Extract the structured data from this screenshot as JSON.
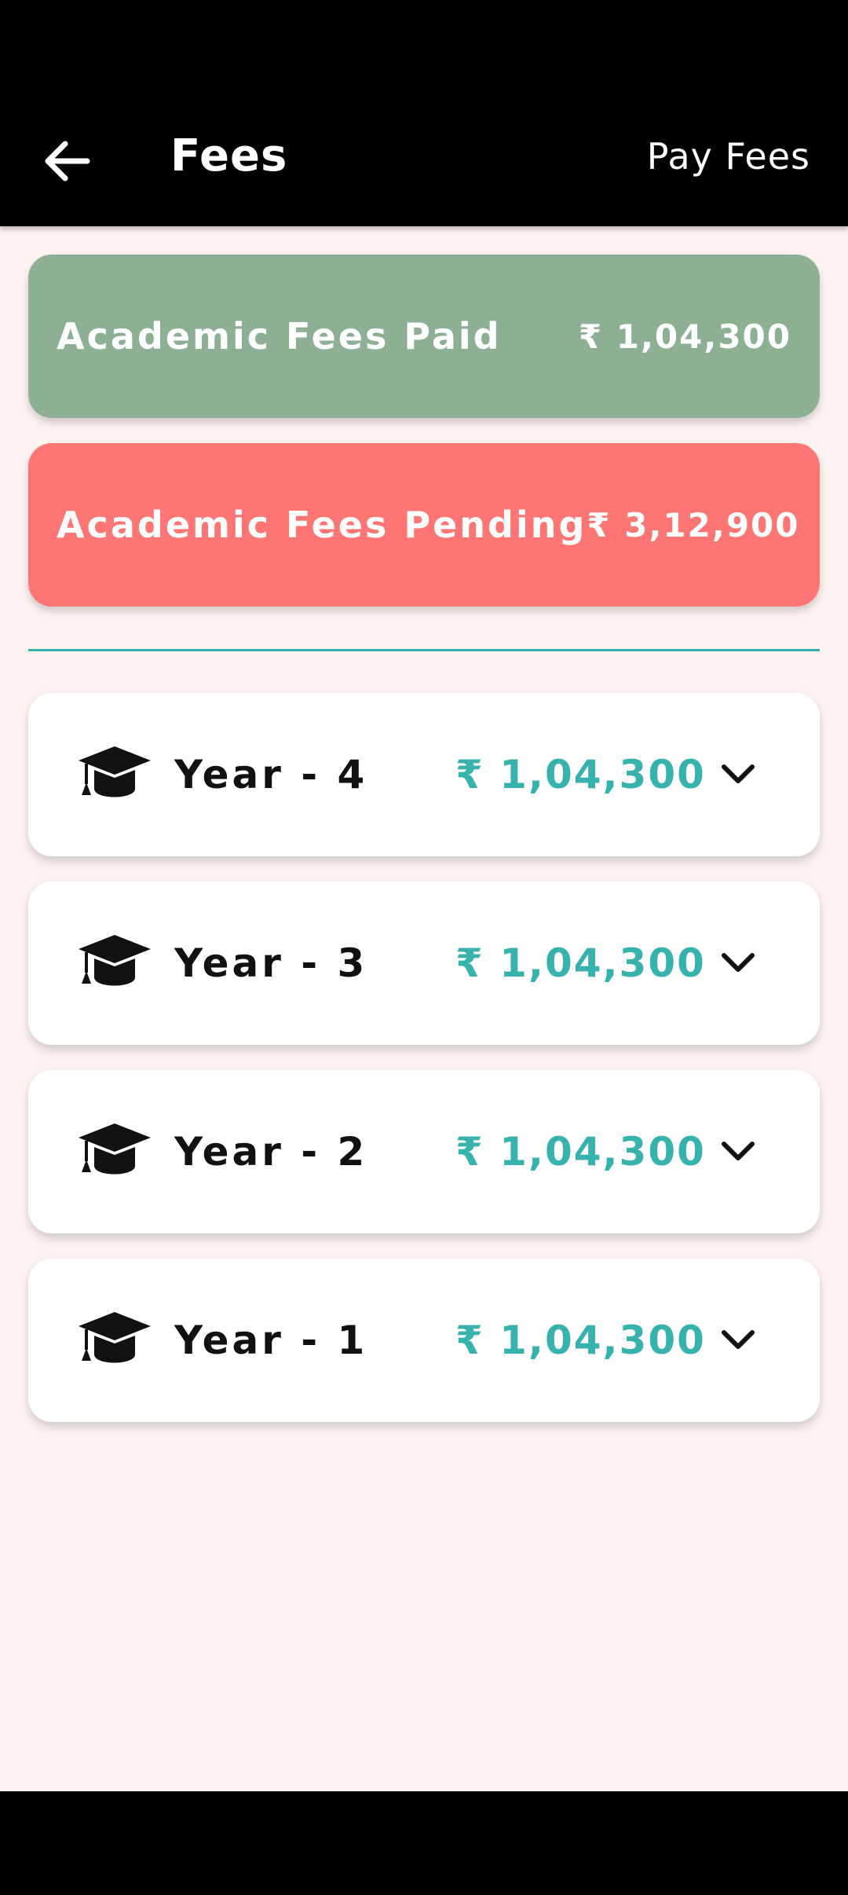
{
  "header": {
    "title": "Fees",
    "action_label": "Pay Fees",
    "back_icon": "arrow-left-icon"
  },
  "summary": {
    "paid": {
      "label": "Academic Fees Paid",
      "amount": "₹ 1,04,300",
      "color": "#8db095"
    },
    "pending": {
      "label": "Academic Fees Pending",
      "amount": "₹ 3,12,900",
      "color": "#fd7674"
    }
  },
  "accent_color": "#38b2ad",
  "years": [
    {
      "label": "Year - 4",
      "amount": "₹ 1,04,300",
      "icon": "graduation-cap-icon"
    },
    {
      "label": "Year - 3",
      "amount": "₹ 1,04,300",
      "icon": "graduation-cap-icon"
    },
    {
      "label": "Year - 2",
      "amount": "₹ 1,04,300",
      "icon": "graduation-cap-icon"
    },
    {
      "label": "Year - 1",
      "amount": "₹ 1,04,300",
      "icon": "graduation-cap-icon"
    }
  ]
}
